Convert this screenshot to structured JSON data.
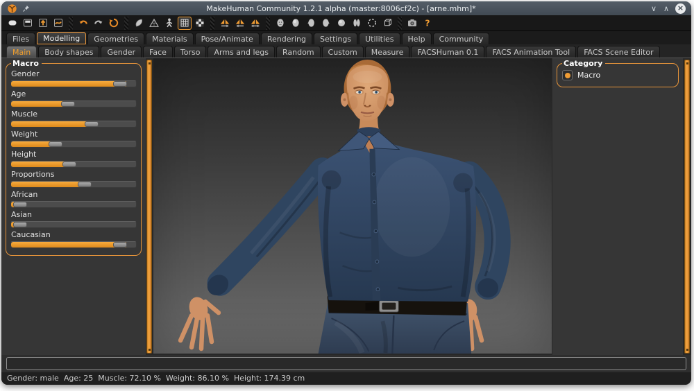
{
  "window": {
    "title": "MakeHuman Community 1.2.1 alpha (master:8006cf2c) - [arne.mhm]*",
    "controls": {
      "minimize": "∨",
      "maximize": "∧",
      "close": "×"
    }
  },
  "toolbar": {
    "active_icon": "grid",
    "groups": [
      [
        "new",
        "load",
        "save",
        "export"
      ],
      [
        "undo",
        "redo",
        "reset"
      ],
      [
        "smooth",
        "wireframe",
        "skeleton",
        "grid",
        "background"
      ],
      [
        "symmetry-right",
        "symmetry-left",
        "symmetry-both"
      ],
      [
        "view-front",
        "view-top",
        "view-side-left",
        "view-side-right",
        "view-back",
        "view-feet",
        "view-orbit",
        "view-perspective"
      ],
      [
        "grab-screen",
        "help"
      ]
    ]
  },
  "main_tabs": {
    "active": "Modelling",
    "items": [
      "Files",
      "Modelling",
      "Geometries",
      "Materials",
      "Pose/Animate",
      "Rendering",
      "Settings",
      "Utilities",
      "Help",
      "Community"
    ]
  },
  "sub_tabs": {
    "active": "Main",
    "items": [
      "Main",
      "Body shapes",
      "Gender",
      "Face",
      "Torso",
      "Arms and legs",
      "Random",
      "Custom",
      "Measure",
      "FACSHuman 0.1",
      "FACS Animation Tool",
      "FACS Scene Editor"
    ]
  },
  "left_panel": {
    "group_label": "Macro",
    "sliders": [
      {
        "label": "Gender",
        "fill": 0.92
      },
      {
        "label": "Age",
        "fill": 0.45
      },
      {
        "label": "Muscle",
        "fill": 0.66
      },
      {
        "label": "Weight",
        "fill": 0.34
      },
      {
        "label": "Height",
        "fill": 0.46
      },
      {
        "label": "Proportions",
        "fill": 0.6
      },
      {
        "label": "African",
        "fill": 0.02
      },
      {
        "label": "Asian",
        "fill": 0.02
      },
      {
        "label": "Caucasian",
        "fill": 0.92
      }
    ]
  },
  "right_panel": {
    "group_label": "Category",
    "options": [
      {
        "label": "Macro",
        "selected": true
      }
    ]
  },
  "viewport": {
    "model": "male-human-figure"
  },
  "status_bar": {
    "text": "Gender: male  Age: 25  Muscle: 72.10 %  Weight: 86.10 %  Height: 174.39 cm"
  },
  "colors": {
    "accent": "#ef9c34",
    "titlebar": "#4a545e",
    "shirt": "#31465f",
    "jeans": "#3a4c64",
    "skin": "#d0946a"
  }
}
